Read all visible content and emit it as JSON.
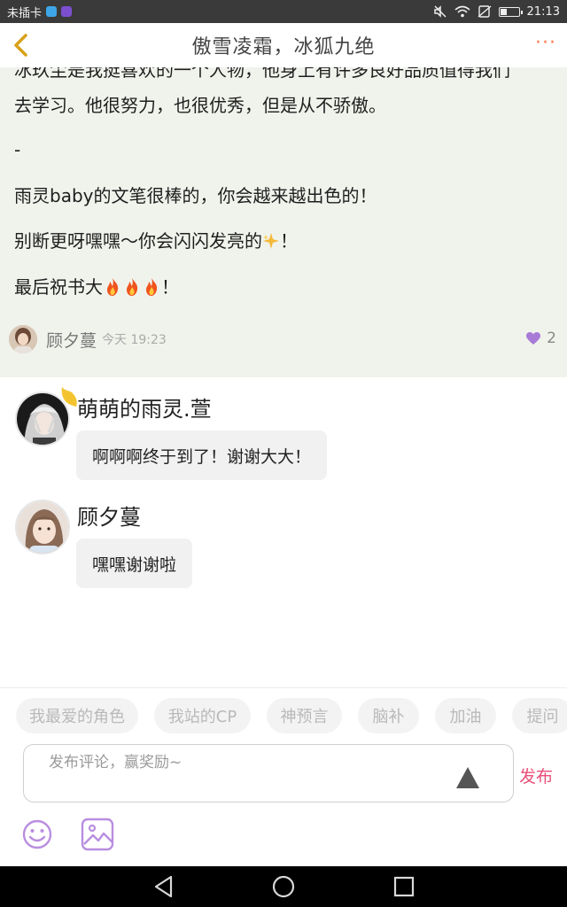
{
  "status_bar": {
    "carrier": "未插卡",
    "time": "21:13",
    "battery_level": 0.35,
    "app_colors": [
      "#3ea6e8",
      "#7b4fd0"
    ]
  },
  "navbar": {
    "title": "傲雪凌霜，冰狐九绝",
    "more_label": "···",
    "back_icon": "chevron-left-icon",
    "back_color": "#d8a11a"
  },
  "post": {
    "lines": [
      "冰玖尘是我挺喜欢的一个人物，他身上有许多良好品质值得我们",
      "去学习。他很努力，也很优秀，但是从不骄傲。",
      "-",
      "雨灵baby的文笔很棒的，你会越来越出色的！",
      "别断更呀嘿嘿～你会闪闪发亮的",
      "！",
      "最后祝书大",
      "！"
    ],
    "author": {
      "name": "顾夕蔓",
      "time": "今天 19:23"
    },
    "like": {
      "icon": "heart-icon",
      "count": "2",
      "color": "#a77bd6"
    },
    "background": "#f0f3ec"
  },
  "comments": [
    {
      "name": "萌萌的雨灵.萱",
      "text": "啊啊啊终于到了！谢谢大大！",
      "badge_icon": "crown-icon"
    },
    {
      "name": "顾夕蔓",
      "text": "嘿嘿谢谢啦"
    }
  ],
  "tags": [
    "我最爱的角色",
    "我站的CP",
    "神预言",
    "脑补",
    "加油",
    "提问"
  ],
  "composer": {
    "placeholder": "发布评论，赢奖励~",
    "publish_label": "发布",
    "publish_color": "#e8507a",
    "emoji_icon": "emoji-icon",
    "image_icon": "image-icon",
    "accent": "#b98ee0"
  },
  "system_nav": {
    "back_icon": "triangle-back-icon",
    "home_icon": "circle-home-icon",
    "recent_icon": "square-recent-icon"
  }
}
